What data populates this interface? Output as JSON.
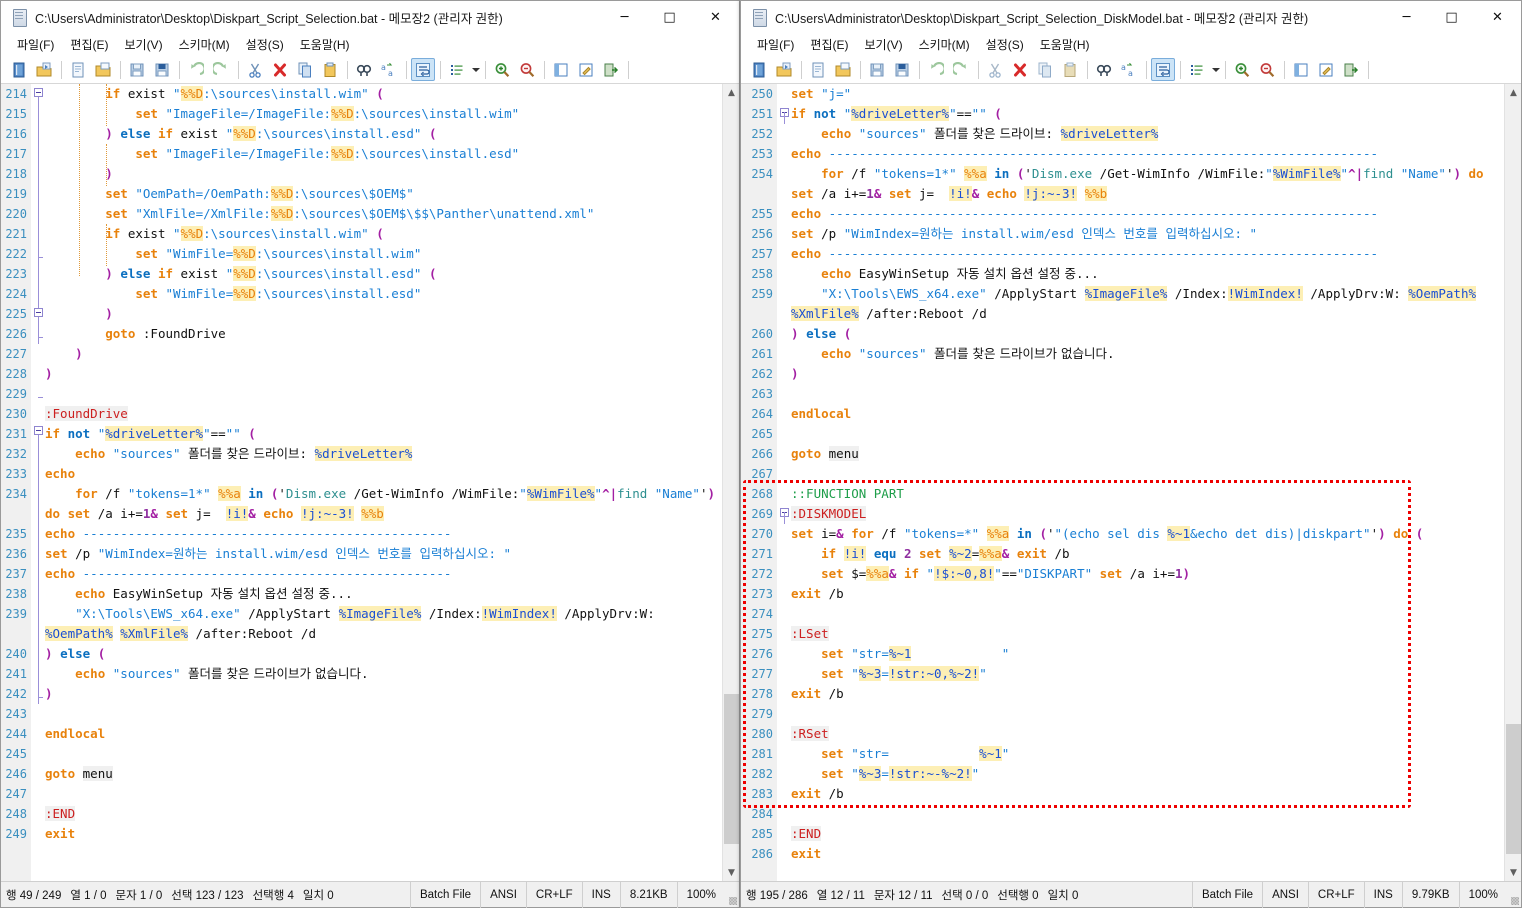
{
  "windows": [
    {
      "id": "left",
      "title": "C:\\Users\\Administrator\\Desktop\\Diskpart_Script_Selection.bat - 메모장2 (관리자 권한)",
      "menus": [
        "파일(F)",
        "편집(E)",
        "보기(V)",
        "스키마(M)",
        "설정(S)",
        "도움말(H)"
      ],
      "window_buttons": {
        "minimize": "─",
        "maximize": "□",
        "close": "✕"
      },
      "toolbar_icons": [
        "new-file-icon",
        "open-file-icon",
        "sep",
        "new-document-icon",
        "open-folder-icon",
        "sep",
        "save-icon",
        "save-as-icon",
        "sep",
        "undo-icon",
        "redo-icon",
        "sep",
        "cut-icon",
        "delete-icon",
        "copy-icon",
        "paste-icon",
        "sep",
        "find-icon",
        "replace-icon",
        "sep",
        "word-wrap-icon",
        "sep",
        "list-icon",
        "list-dropdown-caret-icon",
        "sep",
        "zoom-in-icon",
        "zoom-out-icon",
        "sep",
        "panel-icon",
        "edit-icon",
        "exit-icon"
      ],
      "first_line": 214,
      "last_line": 249,
      "status": {
        "row": "행 49 / 249",
        "col": "열 1 / 0",
        "chars": "문자 1 / 0",
        "selection": "선택 123 / 123",
        "sel_lines": "선택행 4",
        "matches": "일치 0",
        "language": "Batch File",
        "encoding": "ANSI",
        "eol": "CR+LF",
        "insert_mode": "INS",
        "size": "8.21KB",
        "zoom": "100%"
      }
    },
    {
      "id": "right",
      "title": "C:\\Users\\Administrator\\Desktop\\Diskpart_Script_Selection_DiskModel.bat - 메모장2 (관리자 권한)",
      "menus": [
        "파일(F)",
        "편집(E)",
        "보기(V)",
        "스키마(M)",
        "설정(S)",
        "도움말(H)"
      ],
      "window_buttons": {
        "minimize": "─",
        "maximize": "□",
        "close": "✕"
      },
      "first_line": 250,
      "last_line": 286,
      "status": {
        "row": "행 195 / 286",
        "col": "열 12 / 11",
        "chars": "문자 12 / 11",
        "selection": "선택 0 / 0",
        "sel_lines": "선택행 0",
        "matches": "일치 0",
        "language": "Batch File",
        "encoding": "ANSI",
        "eol": "CR+LF",
        "insert_mode": "INS",
        "size": "9.79KB",
        "zoom": "100%"
      }
    }
  ],
  "annotation": {
    "name": "function-part-highlight-box",
    "color": "#ee0000",
    "style": "dotted",
    "covers_lines": "268-283"
  },
  "left_code": [
    {
      "n": 214,
      "t": "        if exist \"%%D:\\sources\\install.wim\" ("
    },
    {
      "n": 215,
      "t": "            set \"ImageFile=/ImageFile:%%D:\\sources\\install.wim\""
    },
    {
      "n": 216,
      "t": "        ) else if exist \"%%D:\\sources\\install.esd\" ("
    },
    {
      "n": 217,
      "t": "            set \"ImageFile=/ImageFile:%%D:\\sources\\install.esd\""
    },
    {
      "n": 218,
      "t": "        )"
    },
    {
      "n": 219,
      "t": "        set \"OemPath=/OemPath:%%D:\\sources\\$OEM$\""
    },
    {
      "n": 220,
      "t": "        set \"XmlFile=/XmlFile:%%D:\\sources\\$OEM$\\$$\\Panther\\unattend.xml\""
    },
    {
      "n": 221,
      "t": "        if exist \"%%D:\\sources\\install.wim\" ("
    },
    {
      "n": 222,
      "t": "            set \"WimFile=%%D:\\sources\\install.wim\""
    },
    {
      "n": 223,
      "t": "        ) else if exist \"%%D:\\sources\\install.esd\" ("
    },
    {
      "n": 224,
      "t": "            set \"WimFile=%%D:\\sources\\install.esd\""
    },
    {
      "n": 225,
      "t": "        )"
    },
    {
      "n": 226,
      "t": "        goto :FoundDrive"
    },
    {
      "n": 227,
      "t": "    )"
    },
    {
      "n": 228,
      "t": ")"
    },
    {
      "n": 229,
      "t": ""
    },
    {
      "n": 230,
      "t": ":FoundDrive"
    },
    {
      "n": 231,
      "t": "if not \"%driveLetter%\"==\"\" ("
    },
    {
      "n": 232,
      "t": "    echo \"sources\" 폴더를 찾은 드라이브: %driveLetter%"
    },
    {
      "n": 233,
      "t": "echo"
    },
    {
      "n": 234,
      "t": "    for /f \"tokens=1*\" %%a in ('Dism.exe /Get-WimInfo /WimFile:\"%WimFile%\"^|find \"Name\"') do set /a i+=1& set j=  !i!& echo !j:~-3! %%b"
    },
    {
      "n": 235,
      "t": "echo -------------------------------------------------"
    },
    {
      "n": 236,
      "t": "set /p \"WimIndex=원하는 install.wim/esd 인덱스 번호를 입력하십시오: \""
    },
    {
      "n": 237,
      "t": "echo -------------------------------------------------"
    },
    {
      "n": 238,
      "t": "    echo EasyWinSetup 자동 설치 옵션 설정 중..."
    },
    {
      "n": 239,
      "t": "    \"X:\\Tools\\EWS_x64.exe\" /ApplyStart %ImageFile% /Index:!WimIndex! /ApplyDrv:W: %OemPath% %XmlFile% /after:Reboot /d"
    },
    {
      "n": 240,
      "t": ") else ("
    },
    {
      "n": 241,
      "t": "    echo \"sources\" 폴더를 찾은 드라이브가 없습니다."
    },
    {
      "n": 242,
      "t": ")"
    },
    {
      "n": 243,
      "t": ""
    },
    {
      "n": 244,
      "t": "endlocal"
    },
    {
      "n": 245,
      "t": ""
    },
    {
      "n": 246,
      "t": "goto menu"
    },
    {
      "n": 247,
      "t": ""
    },
    {
      "n": 248,
      "t": ":END"
    },
    {
      "n": 249,
      "t": "exit"
    }
  ],
  "right_code": [
    {
      "n": 250,
      "t": "set \"j=\""
    },
    {
      "n": 251,
      "t": "if not \"%driveLetter%\"==\"\" ("
    },
    {
      "n": 252,
      "t": "    echo \"sources\" 폴더를 찾은 드라이브: %driveLetter%"
    },
    {
      "n": 253,
      "t": "echo -------------------------------------------------------------------------"
    },
    {
      "n": 254,
      "t": "    for /f \"tokens=1*\" %%a in ('Dism.exe /Get-WimInfo /WimFile:\"%WimFile%\"^|find \"Name\"') do set /a i+=1& set j=  !i!& echo !j:~-3! %%b"
    },
    {
      "n": 255,
      "t": "echo -------------------------------------------------------------------------"
    },
    {
      "n": 256,
      "t": "set /p \"WimIndex=원하는 install.wim/esd 인덱스 번호를 입력하십시오: \""
    },
    {
      "n": 257,
      "t": "echo -------------------------------------------------------------------------"
    },
    {
      "n": 258,
      "t": "    echo EasyWinSetup 자동 설치 옵션 설정 중..."
    },
    {
      "n": 259,
      "t": "    \"X:\\Tools\\EWS_x64.exe\" /ApplyStart %ImageFile% /Index:!WimIndex! /ApplyDrv:W: %OemPath% %XmlFile% /after:Reboot /d"
    },
    {
      "n": 260,
      "t": ") else ("
    },
    {
      "n": 261,
      "t": "    echo \"sources\" 폴더를 찾은 드라이브가 없습니다."
    },
    {
      "n": 262,
      "t": ")"
    },
    {
      "n": 263,
      "t": ""
    },
    {
      "n": 264,
      "t": "endlocal"
    },
    {
      "n": 265,
      "t": ""
    },
    {
      "n": 266,
      "t": "goto menu"
    },
    {
      "n": 267,
      "t": ""
    },
    {
      "n": 268,
      "t": "::FUNCTION PART"
    },
    {
      "n": 269,
      "t": ":DISKMODEL"
    },
    {
      "n": 270,
      "t": "set i=& for /f \"tokens=*\" %%a in ('\"(echo sel dis %~1&echo det dis)|diskpart\"') do ("
    },
    {
      "n": 271,
      "t": "    if !i! equ 2 set %~2=%%a& exit /b"
    },
    {
      "n": 272,
      "t": "    set $=%%a& if \"!$:~0,8!\"==\"DISKPART\" set /a i+=1)"
    },
    {
      "n": 273,
      "t": "exit /b"
    },
    {
      "n": 274,
      "t": ""
    },
    {
      "n": 275,
      "t": ":LSet"
    },
    {
      "n": 276,
      "t": "    set \"str=%~1            \""
    },
    {
      "n": 277,
      "t": "    set \"%~3=!str:~0,%~2!\""
    },
    {
      "n": 278,
      "t": "exit /b"
    },
    {
      "n": 279,
      "t": ""
    },
    {
      "n": 280,
      "t": ":RSet"
    },
    {
      "n": 281,
      "t": "    set \"str=            %~1\""
    },
    {
      "n": 282,
      "t": "    set \"%~3=!str:~-%~2!\""
    },
    {
      "n": 283,
      "t": "exit /b"
    },
    {
      "n": 284,
      "t": ""
    },
    {
      "n": 285,
      "t": ":END"
    },
    {
      "n": 286,
      "t": "exit"
    }
  ]
}
